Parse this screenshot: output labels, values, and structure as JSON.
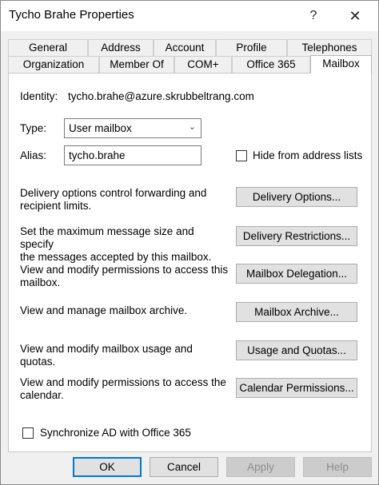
{
  "window": {
    "title": "Tycho Brahe Properties"
  },
  "titlebar": {
    "help_label": "?",
    "close_label": "✕"
  },
  "tabs_row1": [
    "General",
    "Address",
    "Account",
    "Profile",
    "Telephones"
  ],
  "tabs_row2": [
    "Organization",
    "Member Of",
    "COM+",
    "Office 365",
    "Mailbox"
  ],
  "active_tab": "Mailbox",
  "mailbox": {
    "identity_label": "Identity:",
    "identity_value": "tycho.brahe@azure.skrubbeltrang.com",
    "type_label": "Type:",
    "type_value": "User mailbox",
    "alias_label": "Alias:",
    "alias_value": "tycho.brahe",
    "hide_label": "Hide from address lists",
    "hide_checked": false,
    "options": [
      {
        "desc": "Delivery options control forwarding and\nrecipient limits.",
        "button": "Delivery Options..."
      },
      {
        "desc": "Set the maximum message size and specify\nthe messages accepted by this mailbox.",
        "button": "Delivery Restrictions..."
      },
      {
        "desc": "View and modify permissions to access this\nmailbox.",
        "button": "Mailbox Delegation..."
      },
      {
        "desc": "View and manage mailbox archive.",
        "button": "Mailbox Archive..."
      },
      {
        "desc": "View and modify mailbox usage and quotas.",
        "button": "Usage and Quotas..."
      },
      {
        "desc": "View and modify permissions to access the\ncalendar.",
        "button": "Calendar Permissions..."
      }
    ],
    "sync_label": "Synchronize AD with Office 365",
    "sync_checked": false
  },
  "footer": {
    "ok": "OK",
    "cancel": "Cancel",
    "apply": "Apply",
    "help": "Help"
  }
}
